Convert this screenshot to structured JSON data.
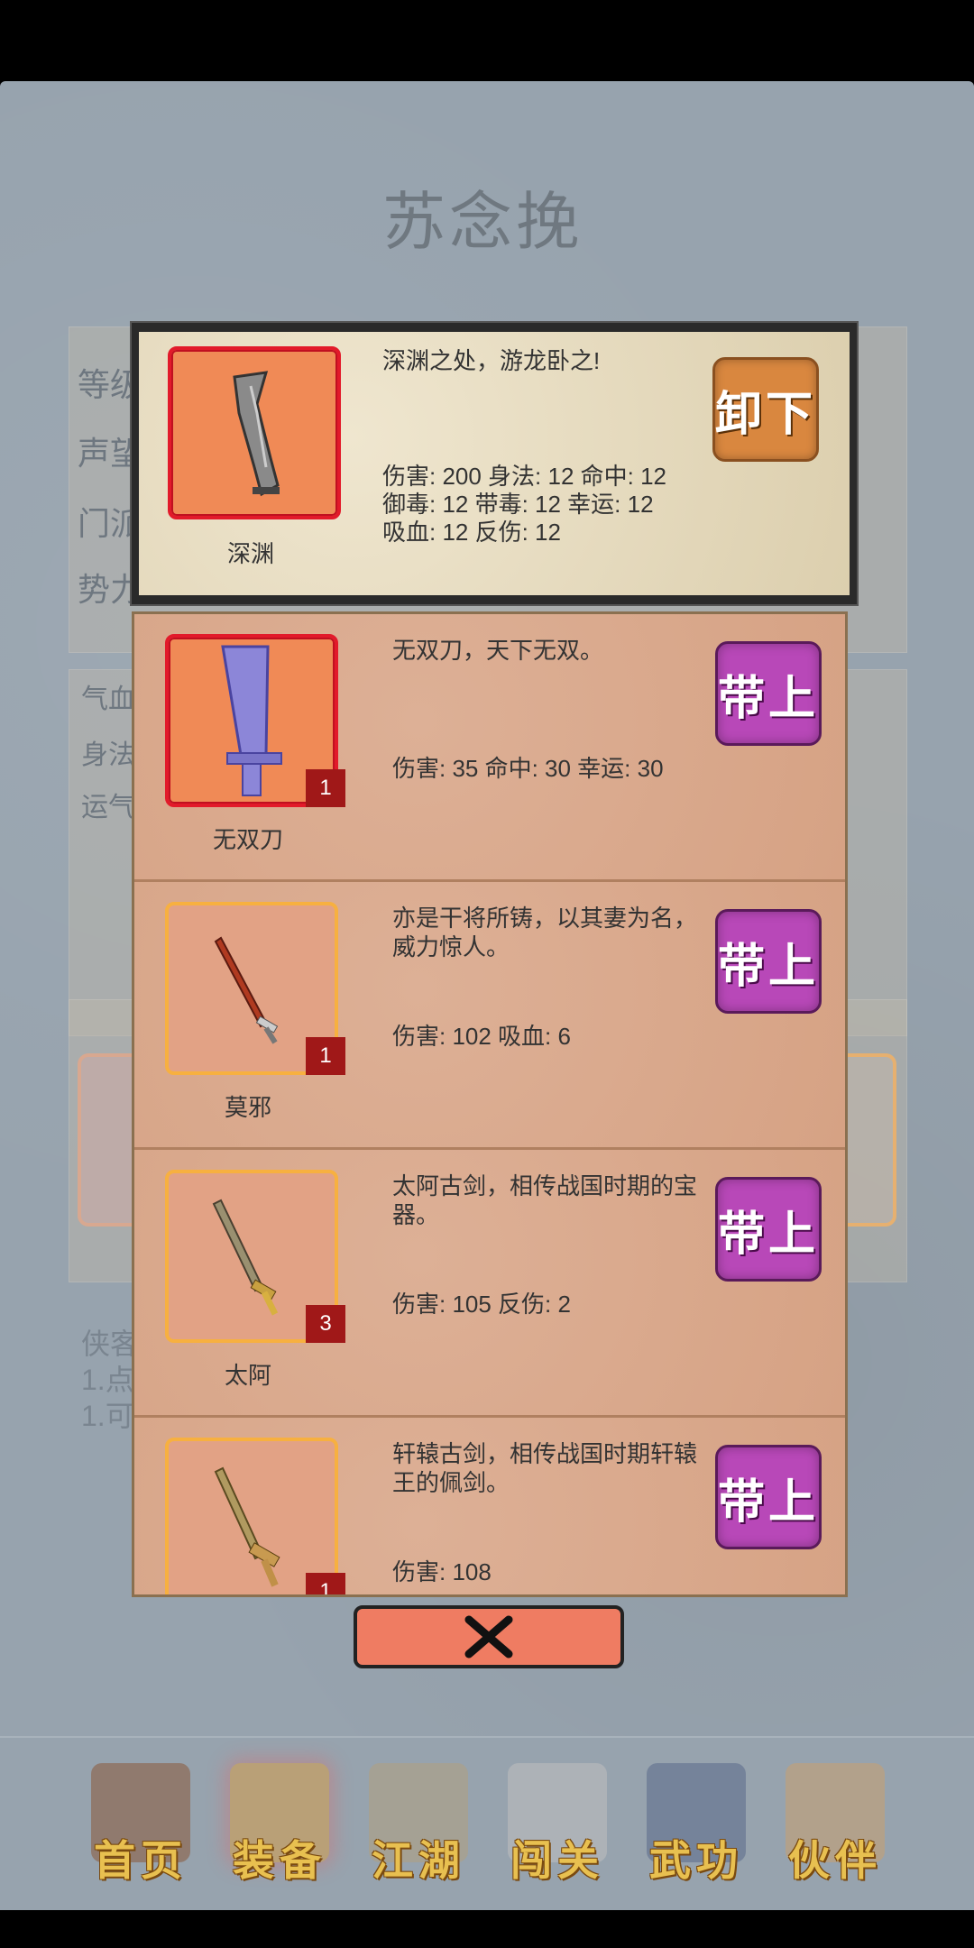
{
  "character": {
    "name": "苏念挽"
  },
  "bg_info": {
    "labels": [
      "等级",
      "声望",
      "门派",
      "势力：皇族"
    ],
    "attrs": [
      "气血",
      "身法",
      "运气"
    ],
    "tips": [
      "侠客",
      "1.点",
      "1.可"
    ]
  },
  "equipped": {
    "name": "深渊",
    "description": "深渊之处，游龙卧之!",
    "stats_line1": "伤害: 200 身法: 12 命中: 12",
    "stats_line2": "御毒: 12 带毒: 12 幸运: 12",
    "stats_line3": "吸血: 12 反伤: 12",
    "button": "卸下"
  },
  "items": [
    {
      "name": "无双刀",
      "description": "无双刀，天下无双。",
      "stats": "伤害: 35 命中: 30 幸运: 30",
      "count": "1",
      "button": "带上",
      "icon": "blade-icon"
    },
    {
      "name": "莫邪",
      "description": "亦是干将所铸，以其妻为名，威力惊人。",
      "stats": "伤害: 102 吸血: 6",
      "count": "1",
      "button": "带上",
      "icon": "red-sword-icon"
    },
    {
      "name": "太阿",
      "description": "太阿古剑，相传战国时期的宝器。",
      "stats": "伤害: 105 反伤: 2",
      "count": "3",
      "button": "带上",
      "icon": "gold-sword-icon"
    },
    {
      "name": "",
      "description": "轩辕古剑，相传战国时期轩辕王的佩剑。",
      "stats": "伤害: 108",
      "count": "1",
      "button": "带上",
      "icon": "bronze-sword-icon"
    }
  ],
  "nav": {
    "home": "首页",
    "equipment": "装备",
    "jianghu": "江湖",
    "challenge": "闯关",
    "martial": "武功",
    "partner": "伙伴"
  },
  "colors": {
    "accent_purple": "#b848b8",
    "accent_orange": "#d9873f",
    "slot_red": "#e21a2a",
    "slot_gold": "#f7b040"
  }
}
